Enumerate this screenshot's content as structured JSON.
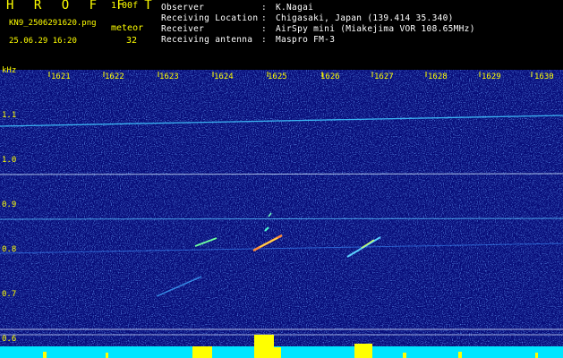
{
  "header": {
    "app_logo": "H R O F F T",
    "version": "1.00f",
    "filename": "KN9_2506291620.png",
    "mode": "meteor",
    "datetime": "25.06.29 16:20",
    "count": "32"
  },
  "info": [
    {
      "key": "Observer",
      "value": "K.Nagai"
    },
    {
      "key": "Receiving Location",
      "value": "Chigasaki, Japan (139.414 35.340)"
    },
    {
      "key": "Receiver",
      "value": "AirSpy mini (Miakejima VOR 108.65MHz)"
    },
    {
      "key": "Receiving antenna",
      "value": "Maspro FM-3"
    }
  ],
  "spectrogram": {
    "y_unit": "kHz",
    "x_ticks": [
      "1621",
      "1622",
      "1623",
      "1624",
      "1625",
      "1626",
      "1627",
      "1628",
      "1629",
      "1630"
    ],
    "y_ticks": [
      "1.1",
      "1.0",
      "0.9",
      "0.8",
      "0.7",
      "0.6"
    ],
    "colors": {
      "background": "#050a7a",
      "trace": "#4ad0ff",
      "bottom_bar": "#00e6ff",
      "peak": "#ffff00",
      "axis_text": "#ffff00"
    }
  }
}
